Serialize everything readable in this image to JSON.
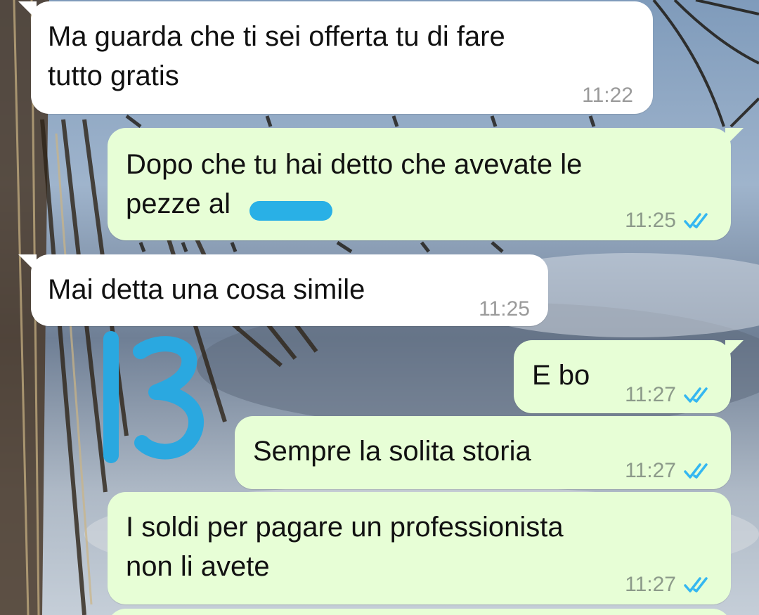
{
  "chat": {
    "messages": [
      {
        "direction": "incoming",
        "text": "Ma guarda che ti sei offerta tu di fare\ntutto gratis",
        "time": "11:22"
      },
      {
        "direction": "outgoing",
        "text": "Dopo che tu hai detto che avevate le\npezze al",
        "time": "11:25",
        "read": true,
        "redacted": true
      },
      {
        "direction": "incoming",
        "text": "Mai detta una cosa simile",
        "time": "11:25"
      },
      {
        "direction": "outgoing",
        "text": "E bo",
        "time": "11:27",
        "read": true
      },
      {
        "direction": "outgoing",
        "text": "Sempre la solita storia",
        "time": "11:27",
        "read": true
      },
      {
        "direction": "outgoing",
        "text": "I soldi per pagare un professionista\nnon li avete",
        "time": "11:27",
        "read": true
      }
    ],
    "annotation": "13"
  },
  "colors": {
    "incoming_bubble": "#ffffff",
    "outgoing_bubble": "#e7fed6",
    "read_ticks": "#34b7f1",
    "redaction": "#29b0e6",
    "annotation_ink": "#2aa8e0"
  },
  "icons": {
    "read_receipt": "double-check-icon"
  }
}
